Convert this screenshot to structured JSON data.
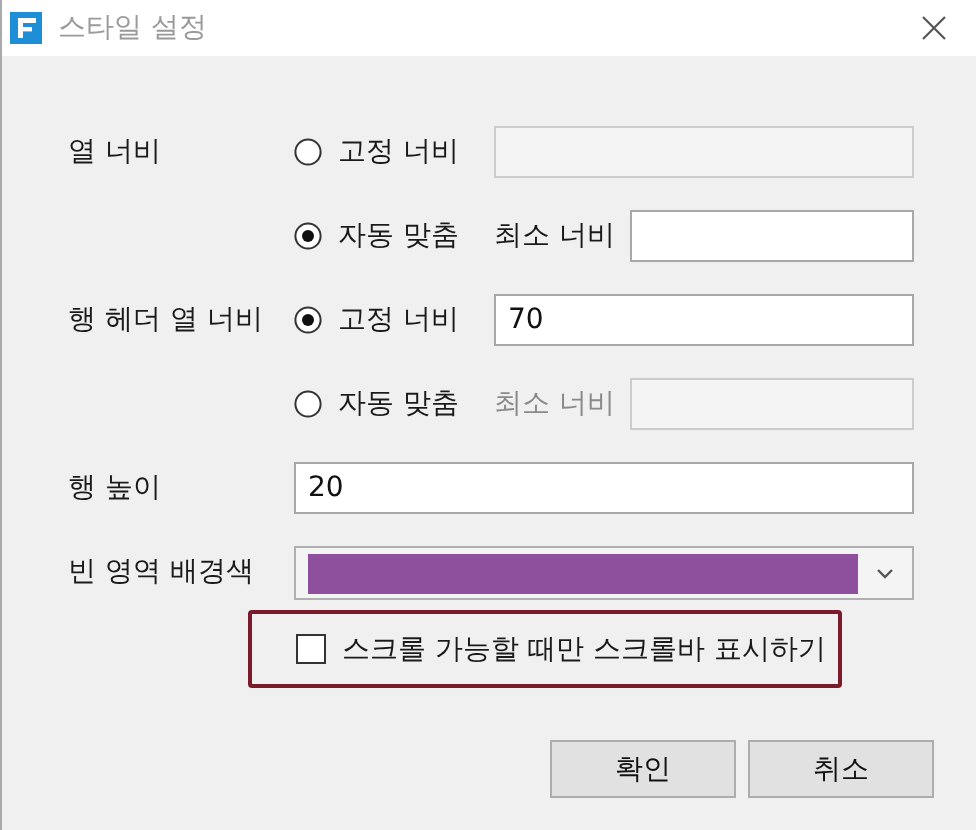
{
  "window": {
    "title": "스타일 설정"
  },
  "settings": [
    {
      "label": "열 너비",
      "options": [
        {
          "label": "고정 너비",
          "selected": false,
          "field": {
            "disabled": true
          }
        },
        {
          "label": "자동 맞춤",
          "selected": true,
          "min_label": "최소 너비",
          "field": {
            "disabled": false
          }
        }
      ]
    },
    {
      "label": "행 헤더 열 너비",
      "options": [
        {
          "label": "고정 너비",
          "selected": true,
          "field": {
            "disabled": false,
            "value": "70"
          }
        },
        {
          "label": "자동 맞춤",
          "selected": false,
          "min_label": "최소 너비",
          "field": {
            "disabled": true
          }
        }
      ]
    },
    {
      "label": "행 높이",
      "kind": "text",
      "field": {
        "disabled": false,
        "value": "20"
      }
    },
    {
      "label": "빈 영역 배경색",
      "kind": "color",
      "color": "#8e4f9d"
    }
  ],
  "checkbox": {
    "label": "스크롤 가능할 때만 스크롤바 표시하기",
    "checked": false,
    "highlighted": true
  },
  "buttons": [
    "확인",
    "취소"
  ]
}
